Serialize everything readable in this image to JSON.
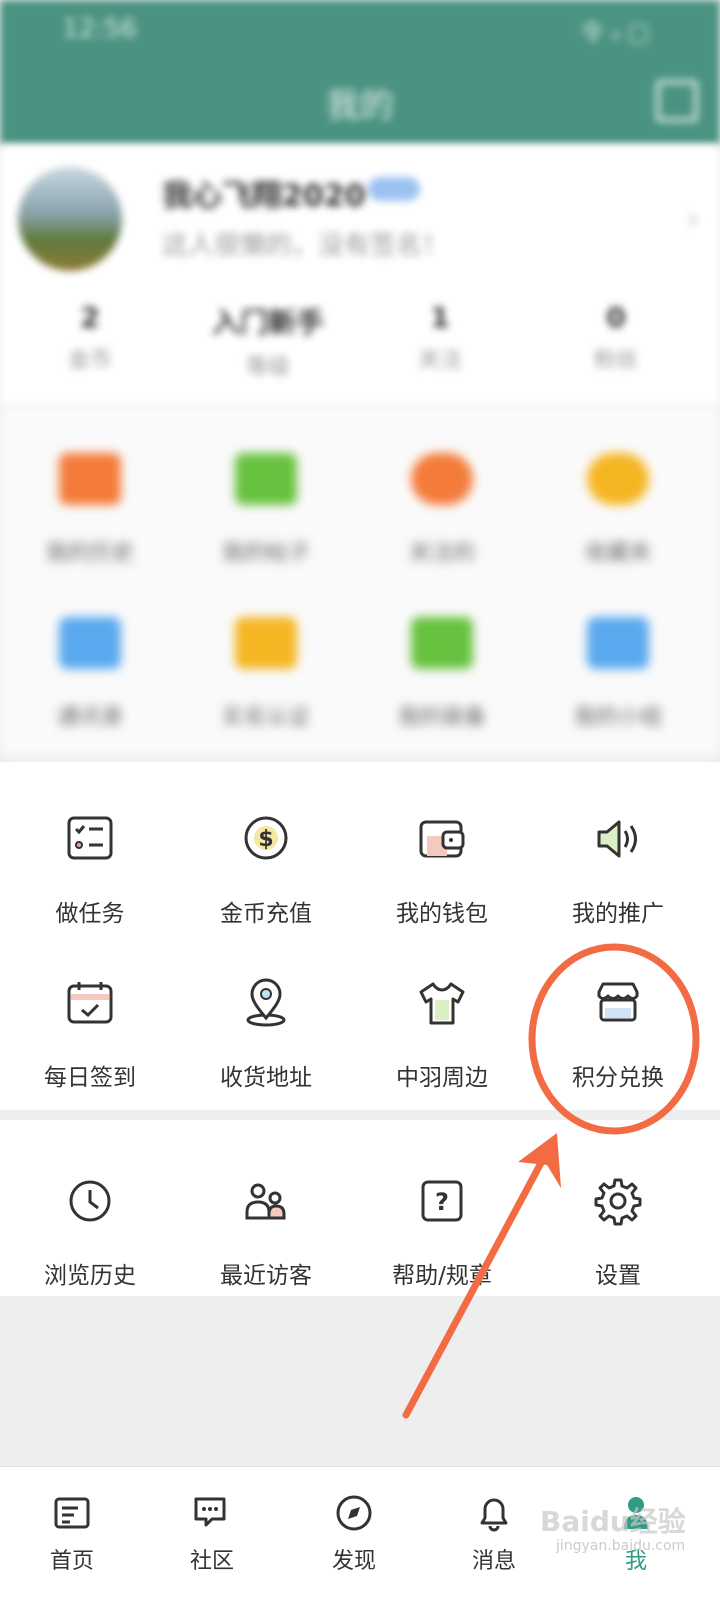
{
  "status_bar": {
    "time": "12:56",
    "icons": "令 ᵢₗ ▢"
  },
  "header": {
    "title": "我的"
  },
  "profile": {
    "username": "我心飞翔2020",
    "bio": "这人很懒的，没有签名！",
    "stats": [
      {
        "value": "2",
        "label": "金币"
      },
      {
        "value": "入门新手",
        "label": "等级"
      },
      {
        "value": "1",
        "label": "关注"
      },
      {
        "value": "0",
        "label": "粉丝"
      }
    ]
  },
  "blurred_grid": [
    {
      "label": "我的历史",
      "color": "#f47b3a"
    },
    {
      "label": "我的帖子",
      "color": "#67c23f"
    },
    {
      "label": "关注的",
      "color": "#f47b3a"
    },
    {
      "label": "收藏夹",
      "color": "#f5b623"
    },
    {
      "label": "通讯录",
      "color": "#5aa9ef"
    },
    {
      "label": "实名认证",
      "color": "#f5b623"
    },
    {
      "label": "我的装备",
      "color": "#67c23f"
    },
    {
      "label": "我的小组",
      "color": "#5aa9ef"
    }
  ],
  "services": [
    {
      "label": "做任务",
      "icon": "task-list-icon"
    },
    {
      "label": "金币充值",
      "icon": "coin-icon"
    },
    {
      "label": "我的钱包",
      "icon": "wallet-icon"
    },
    {
      "label": "我的推广",
      "icon": "speaker-icon"
    },
    {
      "label": "每日签到",
      "icon": "calendar-check-icon"
    },
    {
      "label": "收货地址",
      "icon": "location-pin-icon"
    },
    {
      "label": "中羽周边",
      "icon": "tshirt-icon"
    },
    {
      "label": "积分兑换",
      "icon": "store-icon"
    }
  ],
  "tools": [
    {
      "label": "浏览历史",
      "icon": "clock-icon"
    },
    {
      "label": "最近访客",
      "icon": "users-icon"
    },
    {
      "label": "帮助/规章",
      "icon": "help-icon"
    },
    {
      "label": "设置",
      "icon": "gear-icon"
    }
  ],
  "nav": [
    {
      "label": "首页",
      "icon": "home-icon"
    },
    {
      "label": "社区",
      "icon": "community-icon"
    },
    {
      "label": "发现",
      "icon": "compass-icon"
    },
    {
      "label": "消息",
      "icon": "bell-icon"
    },
    {
      "label": "我",
      "icon": "person-icon"
    }
  ],
  "watermark": {
    "main": "Baidu经验",
    "sub": "jingyan.baidu.com"
  },
  "colors": {
    "header": "#4a9281",
    "accent": "#2e9b84",
    "annotation": "#f26b43"
  }
}
